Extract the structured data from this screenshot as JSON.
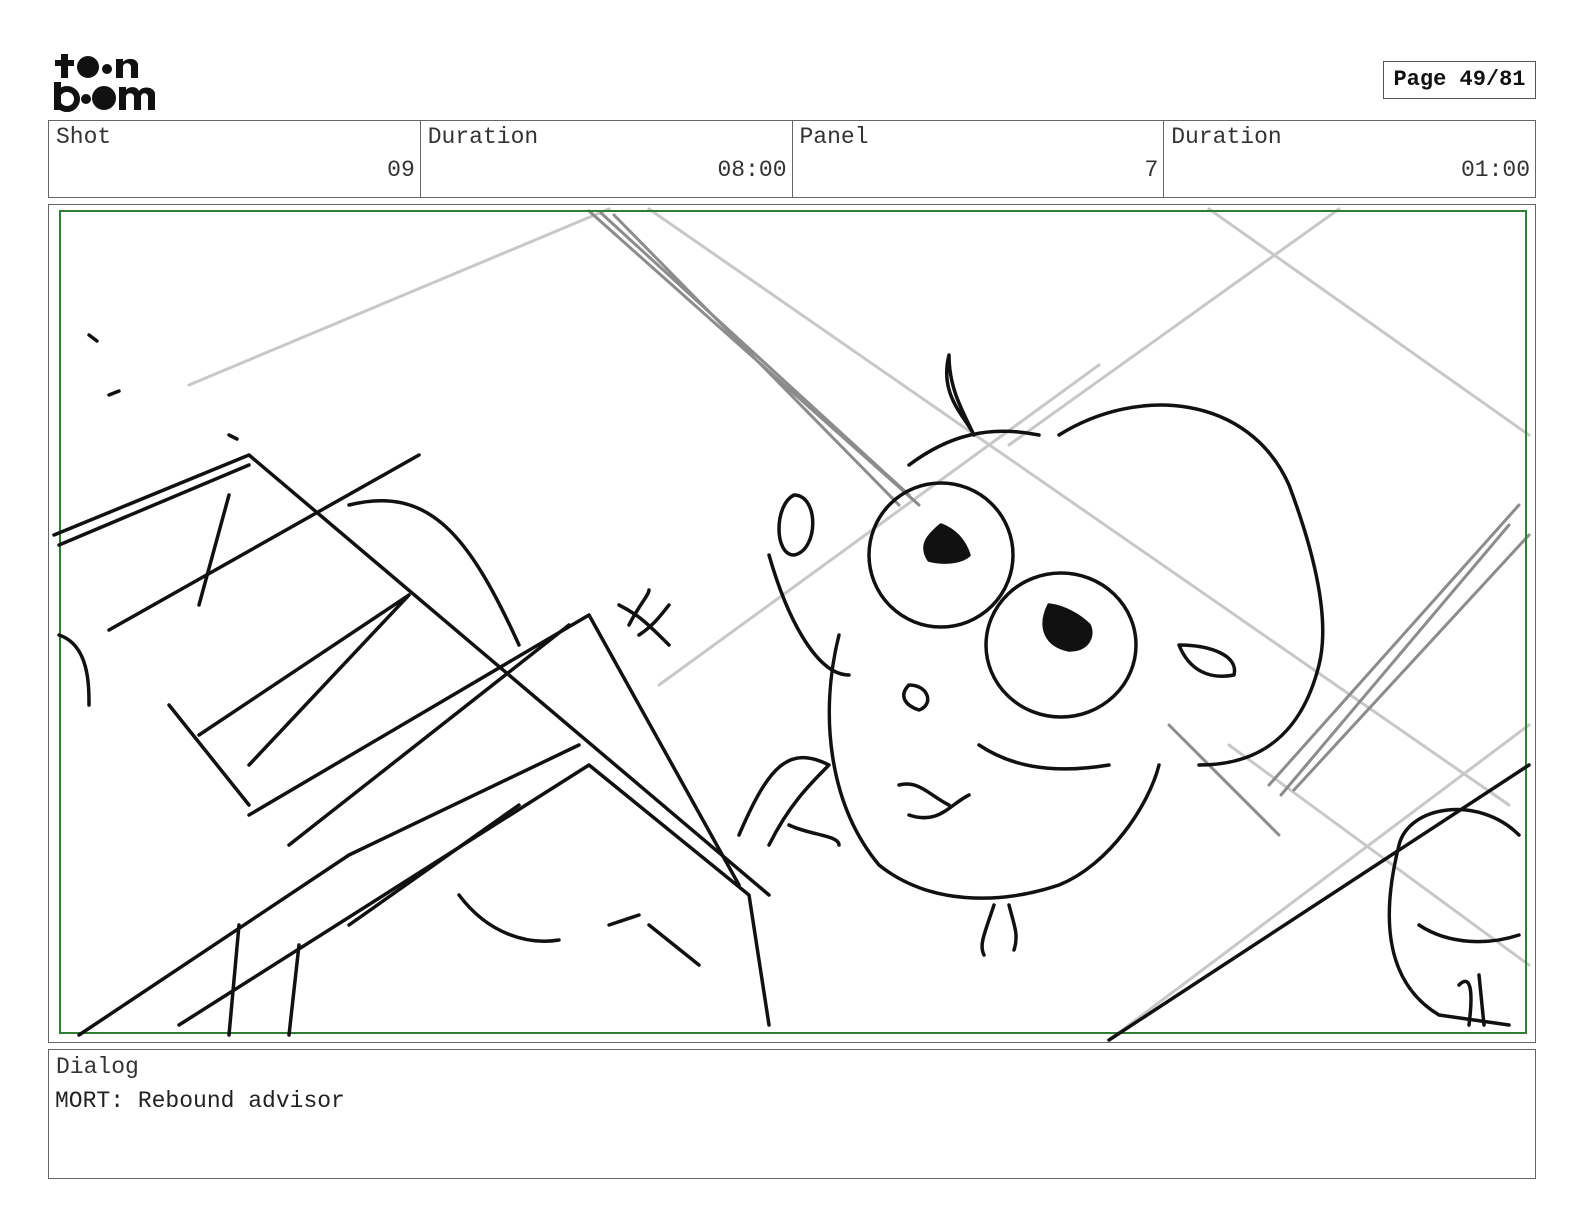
{
  "logo": {
    "line1": "toon",
    "line2": "boom"
  },
  "page": {
    "label": "Page 49/81"
  },
  "info": {
    "shot_label": "Shot",
    "shot_value": "09",
    "duration_label": "Duration",
    "duration_value": "08:00",
    "panel_label": "Panel",
    "panel_value": "7",
    "panel_duration_label": "Duration",
    "panel_duration_value": "01:00"
  },
  "dialog": {
    "label": "Dialog",
    "text": "MORT: Rebound advisor"
  },
  "colors": {
    "safe_frame": "#2e7d32",
    "sketch": "#111111",
    "guide_light": "#c8c8c8",
    "guide_mid": "#8c8c8c"
  }
}
